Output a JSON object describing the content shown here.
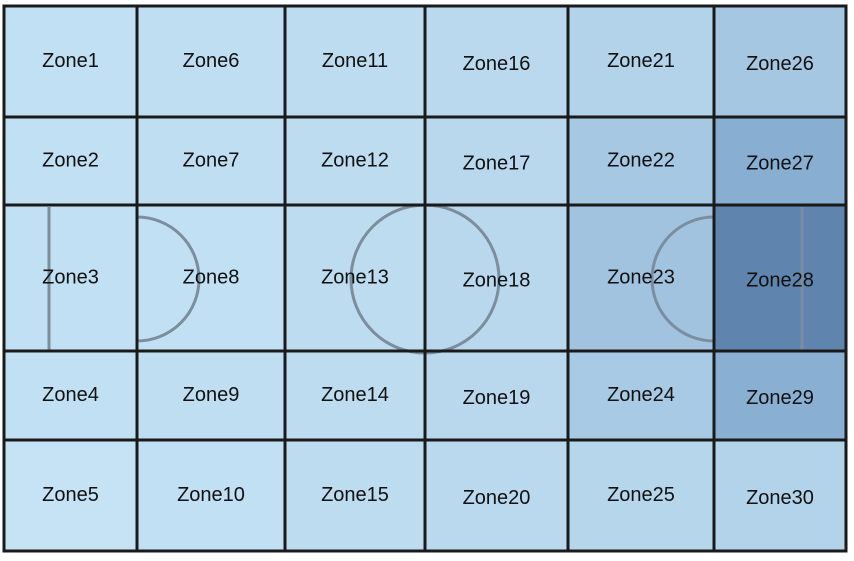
{
  "zones": [
    {
      "label": "Zone1",
      "color": "#c2e0f3"
    },
    {
      "label": "Zone2",
      "color": "#c2e0f3"
    },
    {
      "label": "Zone3",
      "color": "#c2e0f3"
    },
    {
      "label": "Zone4",
      "color": "#c2e0f3"
    },
    {
      "label": "Zone5",
      "color": "#c6e3f5"
    },
    {
      "label": "Zone6",
      "color": "#c0def1"
    },
    {
      "label": "Zone7",
      "color": "#c0def1"
    },
    {
      "label": "Zone8",
      "color": "#c2e0f3"
    },
    {
      "label": "Zone9",
      "color": "#c0def1"
    },
    {
      "label": "Zone10",
      "color": "#c2e0f3"
    },
    {
      "label": "Zone11",
      "color": "#bddcf0"
    },
    {
      "label": "Zone12",
      "color": "#bddcf0"
    },
    {
      "label": "Zone13",
      "color": "#bddcf0"
    },
    {
      "label": "Zone14",
      "color": "#bddcf0"
    },
    {
      "label": "Zone15",
      "color": "#bddcf0"
    },
    {
      "label": "Zone16",
      "color": "#bad9ee"
    },
    {
      "label": "Zone17",
      "color": "#b9d8ed"
    },
    {
      "label": "Zone18",
      "color": "#b9d8ed"
    },
    {
      "label": "Zone19",
      "color": "#b9d8ed"
    },
    {
      "label": "Zone20",
      "color": "#bad9ee"
    },
    {
      "label": "Zone21",
      "color": "#b3d3ea"
    },
    {
      "label": "Zone22",
      "color": "#a7c8e3"
    },
    {
      "label": "Zone23",
      "color": "#a1c3e0"
    },
    {
      "label": "Zone24",
      "color": "#a9cae4"
    },
    {
      "label": "Zone25",
      "color": "#b6d6ec"
    },
    {
      "label": "Zone26",
      "color": "#a6c7e2"
    },
    {
      "label": "Zone27",
      "color": "#88aed2"
    },
    {
      "label": "Zone28",
      "color": "#5f84ad"
    },
    {
      "label": "Zone29",
      "color": "#89afd3"
    },
    {
      "label": "Zone30",
      "color": "#b3d3ea"
    }
  ],
  "colors": {
    "grid_line": "#1a1a1a",
    "pitch_marking": "#7c8e9e"
  }
}
